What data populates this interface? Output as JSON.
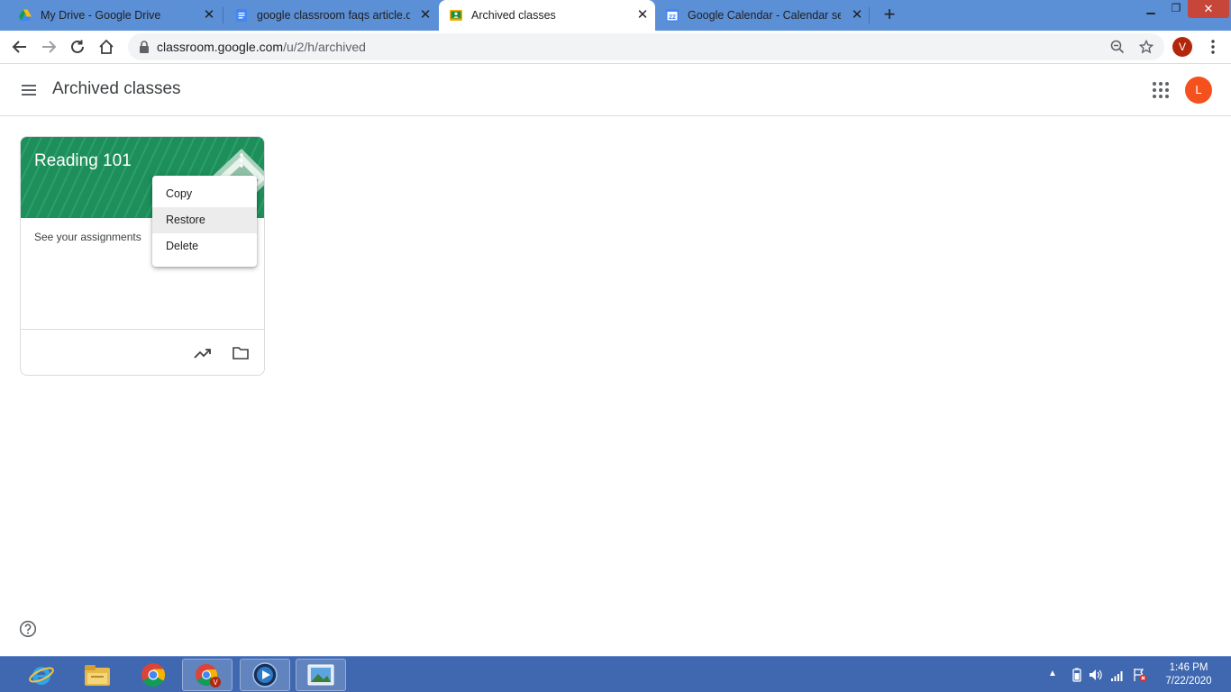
{
  "browser": {
    "tabs": [
      {
        "title": "My Drive - Google Drive",
        "favicon": "google-drive-icon"
      },
      {
        "title": "google classroom faqs article.docx",
        "favicon": "google-docs-icon"
      },
      {
        "title": "Archived classes",
        "favicon": "google-classroom-icon",
        "active": true
      },
      {
        "title": "Google Calendar - Calendar settings",
        "favicon": "google-calendar-icon",
        "badge": "22"
      }
    ],
    "new_tab_label": "+",
    "url_host": "classroom.google.com",
    "url_path": "/u/2/h/archived",
    "profile_initial": "V",
    "profile_color": "#b3260b"
  },
  "header": {
    "title": "Archived classes",
    "avatar_initial": "L",
    "avatar_color": "#f4511e"
  },
  "class_card": {
    "name": "Reading 101",
    "subtitle": "See your assignments",
    "banner_color": "#1e8e5a"
  },
  "context_menu": {
    "items": [
      {
        "label": "Copy"
      },
      {
        "label": "Restore",
        "hovered": true
      },
      {
        "label": "Delete"
      }
    ]
  },
  "taskbar": {
    "apps": [
      "internet-explorer-icon",
      "file-explorer-icon",
      "chrome-icon",
      "chrome-profile-v-icon",
      "media-player-icon",
      "photo-viewer-icon"
    ],
    "time": "1:46 PM",
    "date": "7/22/2020"
  }
}
